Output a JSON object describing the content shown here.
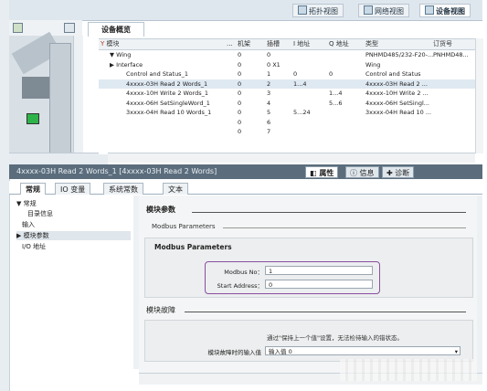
{
  "top_views": [
    "拓扑视图",
    "网络视图",
    "设备视图"
  ],
  "overview_title": "设备概览",
  "device_name": "Wing",
  "table": {
    "headers": [
      "模块",
      "...",
      "机架",
      "插槽",
      "I 地址",
      "Q 地址",
      "类型",
      "订货号"
    ],
    "rows": [
      [
        "▼ Wing",
        "0",
        "0",
        "",
        "",
        "PNHMD485/232-F20-...",
        "PNHMD48..."
      ],
      [
        "  ▶ Interface",
        "0",
        "0 X1",
        "",
        "",
        "Wing",
        ""
      ],
      [
        "Control and Status_1",
        "0",
        "1",
        "0",
        "0",
        "Control and Status",
        ""
      ],
      [
        "4xxxx-03H Read 2 Words_1",
        "0",
        "2",
        "1...4",
        "",
        "4xxxx-03H Read 2 ...",
        ""
      ],
      [
        "4xxxx-10H Write 2 Words_1",
        "0",
        "3",
        "",
        "1...4",
        "4xxxx-10H Write 2 ...",
        ""
      ],
      [
        "4xxxx-06H SetSingleWord_1",
        "0",
        "4",
        "",
        "5...6",
        "4xxxx-06H SetSingl...",
        ""
      ],
      [
        "3xxxx-04H Read 10 Words_1",
        "0",
        "5",
        "5...24",
        "",
        "3xxxx-04H Read 10 ...",
        ""
      ],
      [
        "",
        "0",
        "6",
        "",
        "",
        "",
        ""
      ],
      [
        "",
        "0",
        "7",
        "",
        "",
        "",
        ""
      ]
    ]
  },
  "inspector": {
    "title": "4xxxx-03H Read 2 Words_1 [4xxxx-03H Read 2 Words]",
    "tabs": [
      "属性",
      "信息",
      "诊断"
    ],
    "subtabs": [
      "常规",
      "IO 变量",
      "系统常数",
      "文本"
    ],
    "nav": [
      "▼ 常规",
      "目录信息",
      "输入",
      "▶ 模块参数",
      "I/O 地址"
    ]
  },
  "params": {
    "section": "模块参数",
    "subsection": "Modbus Parameters",
    "panel_header": "Modbus Parameters",
    "modbus_no_label": "Modbus No：",
    "modbus_no_value": "1",
    "start_address_label": "Start Address：",
    "start_address_value": "0",
    "fault_section": "模块故障",
    "fault_note": "通过\"保持上一个值\"设置，无法检待输入的错状态。",
    "fault_label": "模块故障时的输入值",
    "fault_value": "输入值 0"
  },
  "colors": {
    "highlight": "#8a4fa0",
    "inspector_bar": "#5b6d7c"
  }
}
